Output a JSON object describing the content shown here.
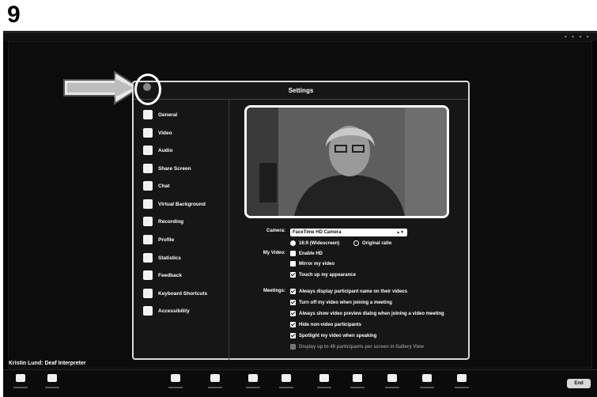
{
  "step_number": "9",
  "window": {
    "participant_name": "Kristin Lund: Deaf Interpreter"
  },
  "settings": {
    "title": "Settings",
    "sidebar": [
      {
        "label": "General",
        "icon": "gear-icon"
      },
      {
        "label": "Video",
        "icon": "video-camera-icon"
      },
      {
        "label": "Audio",
        "icon": "headphones-icon"
      },
      {
        "label": "Share Screen",
        "icon": "share-screen-icon"
      },
      {
        "label": "Chat",
        "icon": "chat-bubble-icon"
      },
      {
        "label": "Virtual Background",
        "icon": "virtual-background-icon"
      },
      {
        "label": "Recording",
        "icon": "recording-icon"
      },
      {
        "label": "Profile",
        "icon": "profile-icon"
      },
      {
        "label": "Statistics",
        "icon": "statistics-icon"
      },
      {
        "label": "Feedback",
        "icon": "feedback-icon"
      },
      {
        "label": "Keyboard Shortcuts",
        "icon": "keyboard-icon"
      },
      {
        "label": "Accessibility",
        "icon": "accessibility-icon"
      }
    ],
    "camera": {
      "label": "Camera:",
      "selected": "FaceTime HD Camera",
      "ratio_169": "16:9 (Widescreen)",
      "ratio_original": "Original ratio"
    },
    "my_video": {
      "label": "My Video:",
      "enable_hd": "Enable HD",
      "mirror": "Mirror my video",
      "touch_up": "Touch up my appearance"
    },
    "meetings": {
      "label": "Meetings:",
      "opt1": "Always display participant name on their videos",
      "opt2": "Turn off my video when joining a meeting",
      "opt3": "Always show video preview dialog when joining a video meeting",
      "opt4": "Hide non-video participants",
      "opt5": "Spotlight my video when speaking",
      "opt6": "Display up to 49 participants per screen in Gallery View"
    }
  },
  "toolbar": {
    "end_label": "End"
  }
}
